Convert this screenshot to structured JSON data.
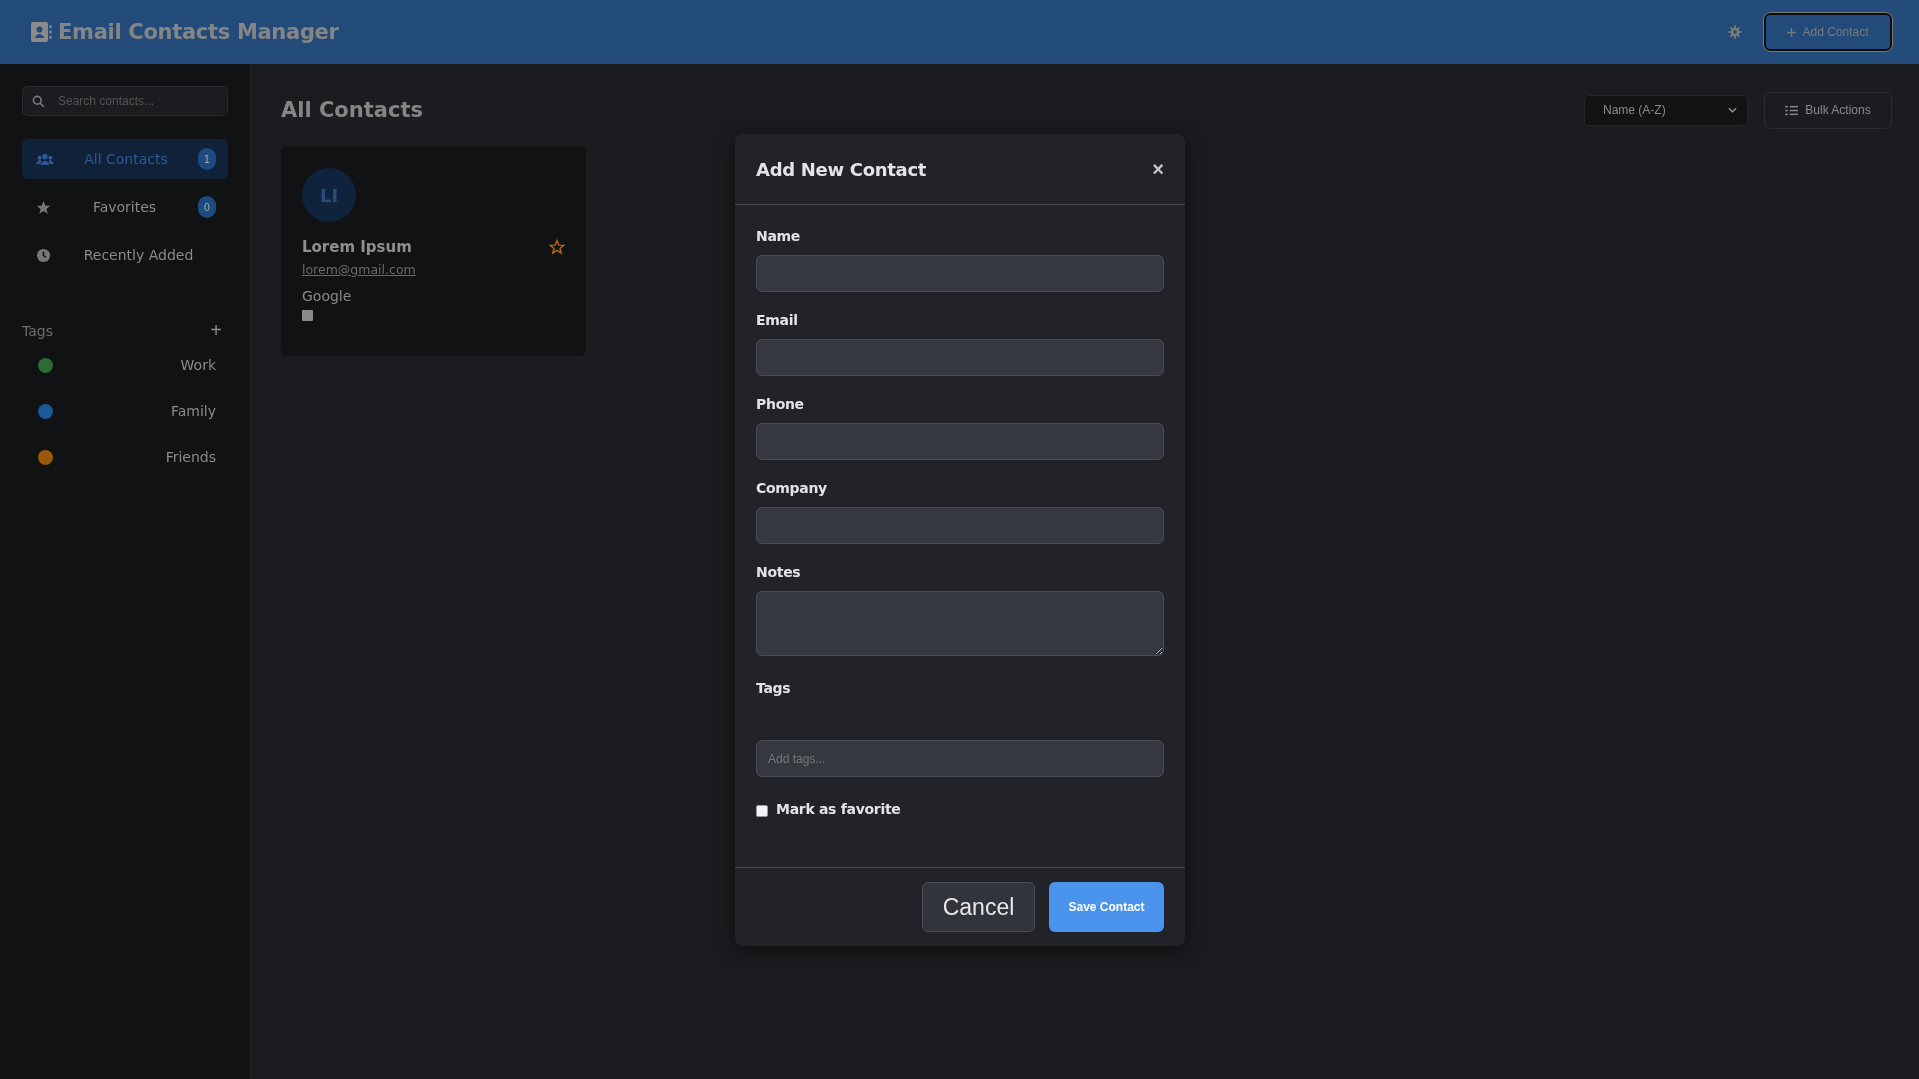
{
  "header": {
    "title": "Email Contacts Manager",
    "add_button": "Add Contact"
  },
  "sidebar": {
    "search": {
      "placeholder": "Search contacts..."
    },
    "nav": [
      {
        "label": "All Contacts",
        "count": "1",
        "selected": true,
        "kind": "people"
      },
      {
        "label": "Favorites",
        "count": "0",
        "selected": false,
        "kind": "star"
      },
      {
        "label": "Recently Added",
        "selected": false,
        "kind": "clock"
      }
    ],
    "tags_heading": "Tags",
    "add_tag_symbol": "+",
    "tags": [
      {
        "label": "Work",
        "color": "#2e6b34"
      },
      {
        "label": "Family",
        "color": "#1a5a96"
      },
      {
        "label": "Friends",
        "color": "#9a5a0a"
      }
    ]
  },
  "main": {
    "title": "All Contacts",
    "sort": {
      "value": "Name (A-Z)"
    },
    "bulk_button": "Bulk Actions",
    "contacts": [
      {
        "initials": "LI",
        "name": "Lorem Ipsum",
        "email": "lorem@gmail.com",
        "company": "Google",
        "favorite": false,
        "checked": false
      }
    ]
  },
  "modal": {
    "title": "Add New Contact",
    "close": "×",
    "fields": [
      {
        "label": "Name",
        "kind": "text"
      },
      {
        "label": "Email",
        "kind": "text"
      },
      {
        "label": "Phone",
        "kind": "text"
      },
      {
        "label": "Company",
        "kind": "text"
      },
      {
        "label": "Notes",
        "kind": "textarea"
      }
    ],
    "tags": {
      "label": "Tags",
      "placeholder": "Add tags..."
    },
    "favorite": {
      "label": "Mark as favorite",
      "checked": false
    },
    "buttons": [
      {
        "label": "Cancel",
        "kind": "secondary"
      },
      {
        "label": "Save Contact",
        "kind": "primary"
      }
    ]
  }
}
